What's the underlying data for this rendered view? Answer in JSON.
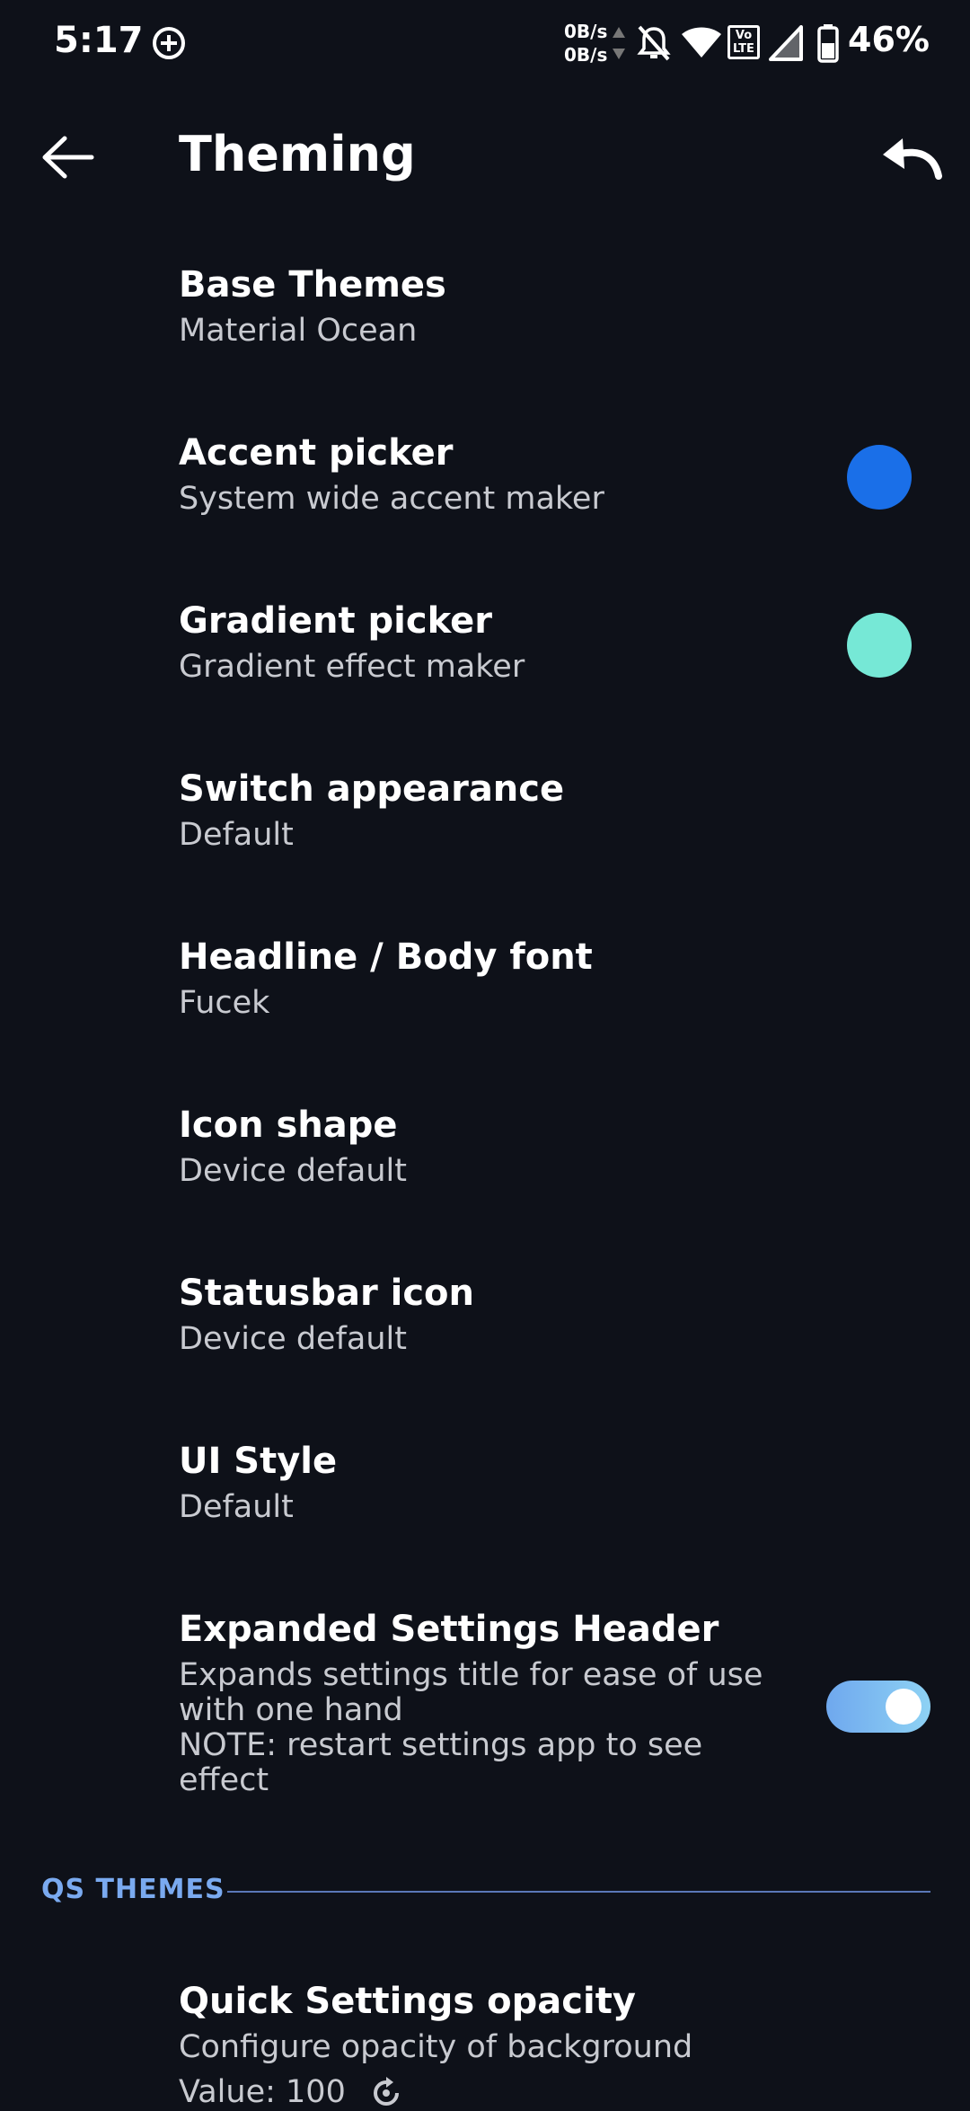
{
  "status_bar": {
    "time": "5:17",
    "net_up": "0B/s",
    "net_down": "0B/s",
    "volte": "Vo LTE",
    "battery": "46%",
    "icons": [
      "notification-icon",
      "data-activity-icon",
      "silent-icon",
      "wifi-icon",
      "volte-icon",
      "signal-icon",
      "battery-icon"
    ]
  },
  "app_bar": {
    "title": "Theming",
    "back_icon": "back-arrow-icon",
    "undo_icon": "undo-icon"
  },
  "preferences": [
    {
      "title": "Base Themes",
      "summary": "Material Ocean"
    },
    {
      "title": "Accent picker",
      "summary": "System wide accent maker",
      "swatch": "#1a6fe8"
    },
    {
      "title": "Gradient picker",
      "summary": "Gradient effect maker",
      "swatch": "#76e8d6"
    },
    {
      "title": "Switch appearance",
      "summary": "Default"
    },
    {
      "title": "Headline / Body font",
      "summary": "Fucek"
    },
    {
      "title": "Icon shape",
      "summary": "Device default"
    },
    {
      "title": "Statusbar icon",
      "summary": "Device default"
    },
    {
      "title": "UI Style",
      "summary": "Default"
    },
    {
      "title": "Expanded Settings Header",
      "summary_lines": [
        "Expands settings title for ease of use",
        "with one hand",
        "NOTE: restart settings app to see",
        "effect"
      ],
      "toggle_on": true
    }
  ],
  "section": {
    "label": "QS THEMES"
  },
  "qs_opacity": {
    "title": "Quick Settings opacity",
    "summary": "Configure opacity of background",
    "value_text": "Value: 100"
  },
  "colors": {
    "background": "#0e1119",
    "accent": "#7aaaf0",
    "toggle_track_start": "#6fa8ee",
    "toggle_track_end": "#8ed2f4",
    "divider": "#5a78b8"
  }
}
